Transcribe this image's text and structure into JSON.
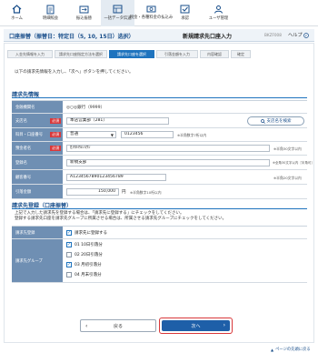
{
  "nav": {
    "items": [
      {
        "label": "ホーム",
        "icon": "home-icon"
      },
      {
        "label": "明細照会",
        "icon": "document-icon"
      },
      {
        "label": "振込振替",
        "icon": "transfer-icon"
      },
      {
        "label": "一括データ伝送",
        "icon": "bulk-data-icon"
      },
      {
        "label": "税金・各種料金の払込み",
        "icon": "tax-payment-icon"
      },
      {
        "label": "承認",
        "icon": "approval-icon"
      },
      {
        "label": "ユーザ管理",
        "icon": "user-management-icon"
      }
    ]
  },
  "title": {
    "service": "口座振替（振替日：特定日（5, 10, 15日）选択）",
    "page": "新規請求先口座入力",
    "code": "BKZF008",
    "help": "ヘルプ"
  },
  "steps": [
    "入金先情報を入力",
    "請求先口座指定方法を選択",
    "請求先口座を選択",
    "引落金額を入力",
    "内容確認",
    "確定"
  ],
  "intro": "以下の請求先情報を入力し、「次へ」ボタンを押してください。",
  "billing": {
    "heading": "請求先情報",
    "fields": [
      {
        "label": "金融機関名",
        "value": "◎○◎銀行（9999）",
        "required": false
      },
      {
        "label": "支店名",
        "value": "本店営業部（281）",
        "required": true,
        "button": "支店名を検索"
      },
      {
        "label": "科目・口座番号",
        "account_type": "普通",
        "account_no": "0123456",
        "note": "※半角数字7桁以内",
        "required": true
      },
      {
        "label": "預金者名",
        "value": "ｶ)ﾏﾙﾏﾙｼｮｳｼﾞ",
        "note": "※半角30文字以内",
        "required": true
      },
      {
        "label": "登録名",
        "value": "新規支部",
        "note": "※全角30文字以内［半角可］",
        "required": false
      },
      {
        "label": "顧客番号",
        "value": "A12345678901234567​89",
        "note": "※半角20文字以内",
        "required": false
      },
      {
        "label": "引落金額",
        "value": "150,000",
        "unit": "円",
        "note": "※半角数字10桁以内",
        "required": false
      }
    ]
  },
  "registration": {
    "heading": "請求先登録（口座振替）",
    "notes": [
      "上記で入力した請求先を登録する場合は、「請求先に登録する」にチェックをしてください。",
      "登録する請求先口座を請求先グループに所属させる場合は、所属させる請求先グループにチェックをしてください。"
    ],
    "register_label": "請求先登録",
    "register_option": "請求先に登録する",
    "group_label": "請求先グループ",
    "groups": [
      {
        "label": "01 10日引落分",
        "checked": true
      },
      {
        "label": "02 20日引落分",
        "checked": false
      },
      {
        "label": "03 月初引落分",
        "checked": true
      },
      {
        "label": "04 月末引落分",
        "checked": false
      }
    ]
  },
  "buttons": {
    "back": "戻る",
    "next": "次へ"
  },
  "pagetop": "ページの先頭に戻る",
  "colors": {
    "primary": "#1e73be",
    "label_bg": "#6f8fb3",
    "required": "#d9383a",
    "accent": "#1a4f8b"
  }
}
